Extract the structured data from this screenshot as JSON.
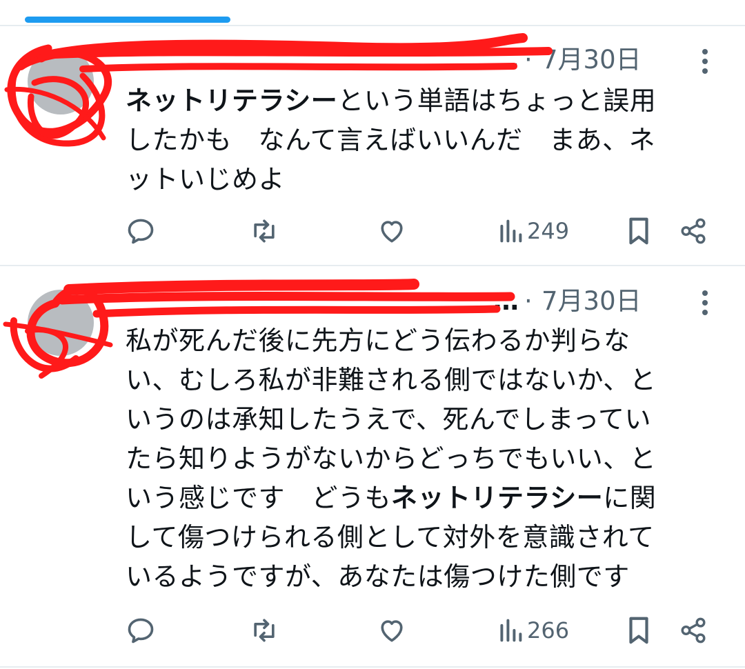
{
  "tweets": [
    {
      "author_display": "…",
      "separator": "·",
      "date": "7月30日",
      "text_lines": [
        [
          {
            "b": true,
            "t": "ネットリテラシー"
          },
          {
            "b": false,
            "t": "という単語はちょっと誤用"
          }
        ],
        [
          {
            "b": false,
            "t": "したかも　なんて言えばいいんだ　まあ、ネ"
          }
        ],
        [
          {
            "b": false,
            "t": "ットいじめよ"
          }
        ]
      ],
      "views": "249"
    },
    {
      "author_display": "…",
      "separator": "·",
      "date": "7月30日",
      "text_lines": [
        [
          {
            "b": false,
            "t": "私が死んだ後に先方にどう伝わるか判らな"
          }
        ],
        [
          {
            "b": false,
            "t": "い、むしろ私が非難される側ではないか、と"
          }
        ],
        [
          {
            "b": false,
            "t": "いうのは承知したうえで、死んでしまってい"
          }
        ],
        [
          {
            "b": false,
            "t": "たら知りようがないからどっちでもいい、と"
          }
        ],
        [
          {
            "b": false,
            "t": "いう感じです　どうも"
          },
          {
            "b": true,
            "t": "ネットリテラシー"
          },
          {
            "b": false,
            "t": "に関"
          }
        ],
        [
          {
            "b": false,
            "t": "して傷つけられる側として対外を意識されて"
          }
        ],
        [
          {
            "b": false,
            "t": "いるようですが、あなたは傷つけた側です"
          }
        ]
      ],
      "views": "266"
    }
  ],
  "icons": [
    "reply-icon",
    "retweet-icon",
    "like-icon",
    "views-icon",
    "bookmark-icon",
    "share-icon",
    "more-icon"
  ],
  "colors": {
    "accent": "#1d9bf0",
    "text": "#0f1419",
    "secondary": "#536471",
    "redaction": "#ff0000"
  }
}
